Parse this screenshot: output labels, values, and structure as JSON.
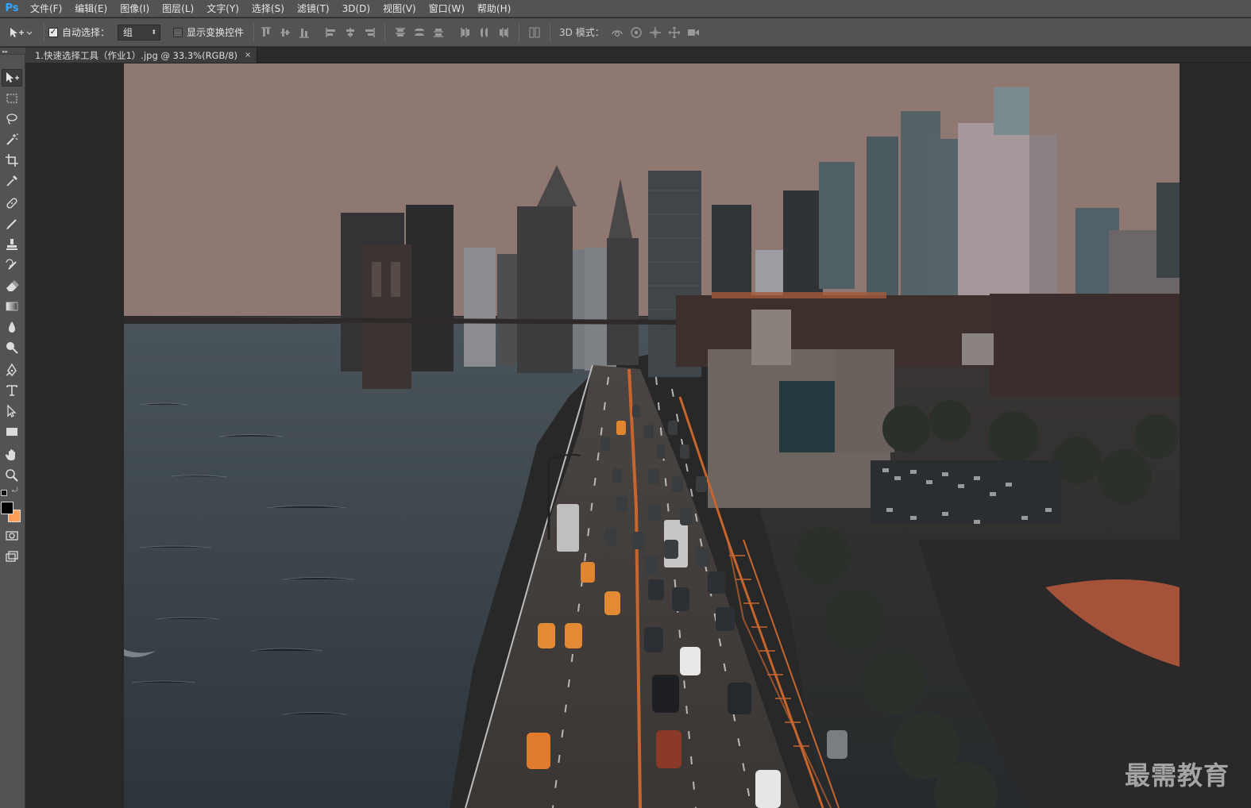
{
  "app": {
    "logo": "Ps"
  },
  "menu": {
    "items": [
      {
        "label": "文件(F)"
      },
      {
        "label": "编辑(E)"
      },
      {
        "label": "图像(I)"
      },
      {
        "label": "图层(L)"
      },
      {
        "label": "文字(Y)"
      },
      {
        "label": "选择(S)"
      },
      {
        "label": "滤镜(T)"
      },
      {
        "label": "3D(D)"
      },
      {
        "label": "视图(V)"
      },
      {
        "label": "窗口(W)"
      },
      {
        "label": "帮助(H)"
      }
    ]
  },
  "options": {
    "tool_icon": "move-tool-icon",
    "auto_select_label": "自动选择：",
    "auto_select_checked": true,
    "auto_select_value": "组",
    "show_transform_label": "显示变换控件",
    "show_transform_checked": false,
    "mode_3d_label": "3D 模式："
  },
  "document": {
    "tab_title": "1.快速选择工具（作业1）.jpg @ 33.3%(RGB/8)",
    "close_glyph": "×",
    "zoom": "33.3%",
    "color_mode": "RGB/8"
  },
  "toolbox": {
    "tools": [
      {
        "name": "move-tool-icon",
        "active": true
      },
      {
        "name": "rectangular-marquee-tool-icon"
      },
      {
        "name": "lasso-tool-icon"
      },
      {
        "name": "quick-selection-tool-icon"
      },
      {
        "name": "crop-tool-icon"
      },
      {
        "name": "eyedropper-tool-icon"
      },
      {
        "name": "spot-healing-brush-tool-icon"
      },
      {
        "name": "brush-tool-icon"
      },
      {
        "name": "clone-stamp-tool-icon"
      },
      {
        "name": "history-brush-tool-icon"
      },
      {
        "name": "eraser-tool-icon"
      },
      {
        "name": "gradient-tool-icon"
      },
      {
        "name": "blur-tool-icon"
      },
      {
        "name": "dodge-tool-icon"
      },
      {
        "name": "pen-tool-icon"
      },
      {
        "name": "type-tool-icon"
      },
      {
        "name": "path-selection-tool-icon"
      },
      {
        "name": "rectangle-tool-icon"
      },
      {
        "name": "hand-tool-icon"
      },
      {
        "name": "zoom-tool-icon"
      },
      {
        "name": "quick-mask-icon"
      },
      {
        "name": "screen-mode-icon"
      }
    ],
    "foreground_color": "#000000",
    "background_color": "#ff9e57"
  },
  "watermark": {
    "text": "最需教育"
  }
}
